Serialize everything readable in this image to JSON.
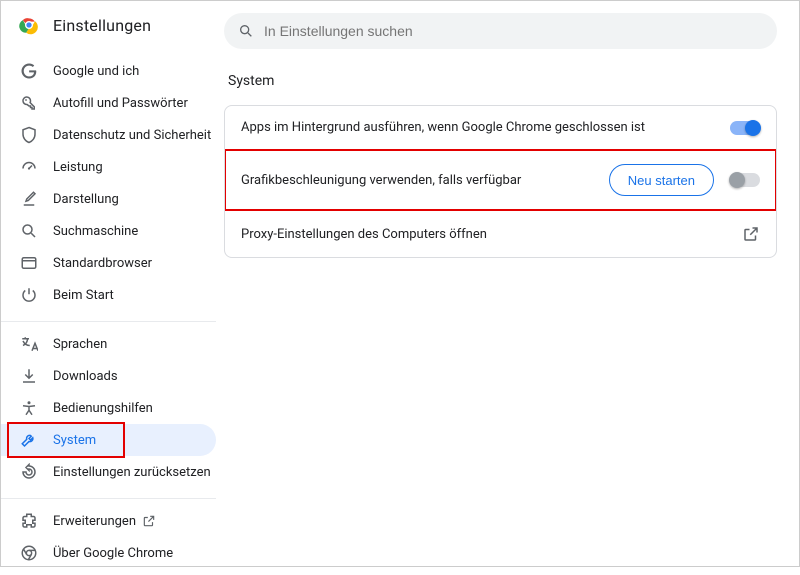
{
  "app_title": "Einstellungen",
  "search": {
    "placeholder": "In Einstellungen suchen"
  },
  "sidebar": {
    "group1": [
      {
        "label": "Google und ich"
      },
      {
        "label": "Autofill und Passwörter"
      },
      {
        "label": "Datenschutz und Sicherheit"
      },
      {
        "label": "Leistung"
      },
      {
        "label": "Darstellung"
      },
      {
        "label": "Suchmaschine"
      },
      {
        "label": "Standardbrowser"
      },
      {
        "label": "Beim Start"
      }
    ],
    "group2": [
      {
        "label": "Sprachen"
      },
      {
        "label": "Downloads"
      },
      {
        "label": "Bedienungshilfen"
      },
      {
        "label": "System"
      },
      {
        "label": "Einstellungen zurücksetzen"
      }
    ],
    "group3": [
      {
        "label": "Erweiterungen"
      },
      {
        "label": "Über Google Chrome"
      }
    ]
  },
  "section": {
    "title": "System"
  },
  "rows": {
    "bg": {
      "label": "Apps im Hintergrund ausführen, wenn Google Chrome geschlossen ist"
    },
    "gpu": {
      "label": "Grafikbeschleunigung verwenden, falls verfügbar",
      "restart": "Neu starten"
    },
    "proxy": {
      "label": "Proxy-Einstellungen des Computers öffnen"
    }
  }
}
